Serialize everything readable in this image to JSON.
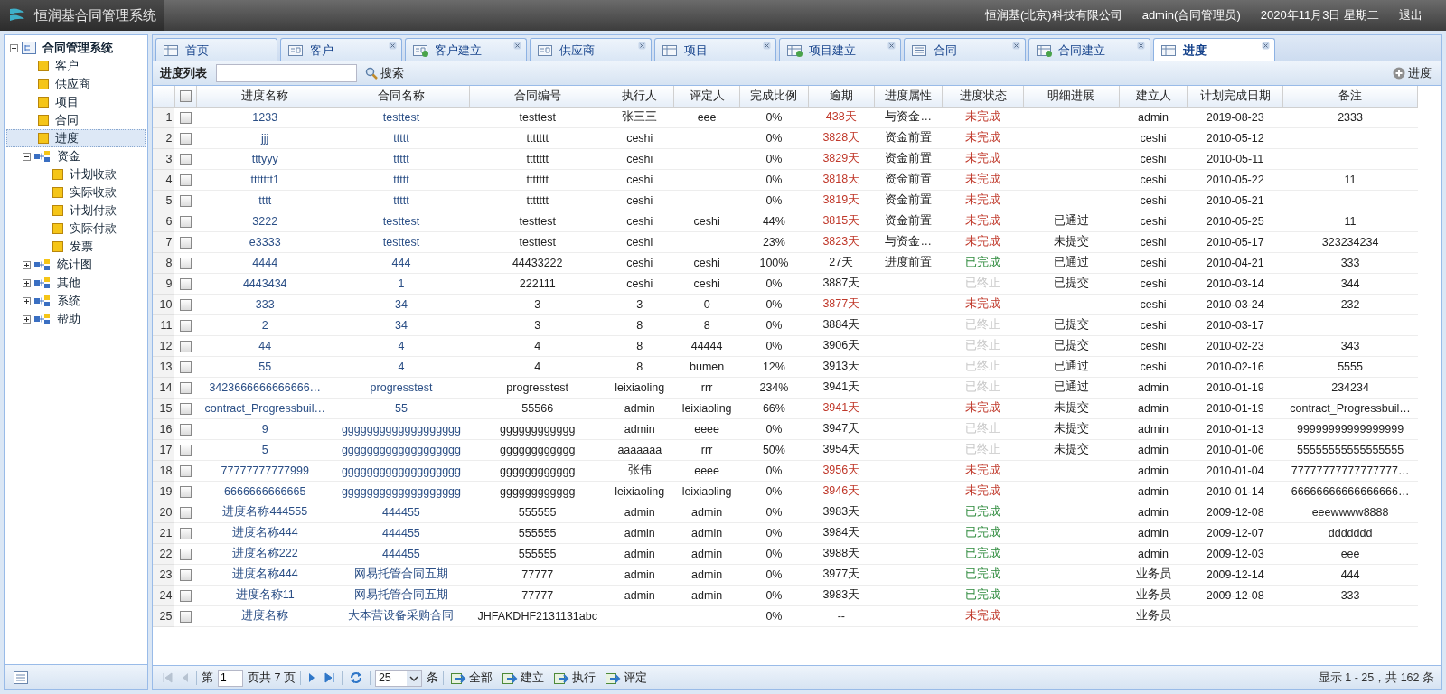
{
  "header": {
    "title": "恒润基合同管理系统",
    "company": "恒润基(北京)科技有限公司",
    "user": "admin(合同管理员)",
    "date": "2020年11月3日 星期二",
    "logout": "退出"
  },
  "sidebar": {
    "tree": [
      {
        "label": "合同管理系统",
        "kind": "root",
        "expanded": true,
        "children": [
          {
            "label": "客户",
            "kind": "leaf",
            "selected": false
          },
          {
            "label": "供应商",
            "kind": "leaf",
            "selected": false
          },
          {
            "label": "项目",
            "kind": "leaf",
            "selected": false
          },
          {
            "label": "合同",
            "kind": "leaf",
            "selected": false
          },
          {
            "label": "进度",
            "kind": "leaf",
            "selected": true
          },
          {
            "label": "资金",
            "kind": "folder",
            "expanded": true,
            "children": [
              {
                "label": "计划收款",
                "kind": "leaf",
                "selected": false
              },
              {
                "label": "实际收款",
                "kind": "leaf",
                "selected": false
              },
              {
                "label": "计划付款",
                "kind": "leaf",
                "selected": false
              },
              {
                "label": "实际付款",
                "kind": "leaf",
                "selected": false
              },
              {
                "label": "发票",
                "kind": "leaf",
                "selected": false
              }
            ]
          },
          {
            "label": "统计图",
            "kind": "folder",
            "expanded": false
          },
          {
            "label": "其他",
            "kind": "folder",
            "expanded": false
          },
          {
            "label": "系统",
            "kind": "folder",
            "expanded": false
          },
          {
            "label": "帮助",
            "kind": "folder",
            "expanded": false
          }
        ]
      }
    ]
  },
  "tabs": [
    {
      "label": "首页",
      "kind": "window",
      "closable": false,
      "selected": false
    },
    {
      "label": "客户",
      "kind": "card",
      "closable": true,
      "selected": false
    },
    {
      "label": "客户建立",
      "kind": "card-add",
      "closable": true,
      "selected": false
    },
    {
      "label": "供应商",
      "kind": "card",
      "closable": true,
      "selected": false
    },
    {
      "label": "项目",
      "kind": "window",
      "closable": true,
      "selected": false
    },
    {
      "label": "项目建立",
      "kind": "window-add",
      "closable": true,
      "selected": false
    },
    {
      "label": "合同",
      "kind": "list",
      "closable": true,
      "selected": false
    },
    {
      "label": "合同建立",
      "kind": "window-add",
      "closable": true,
      "selected": false
    },
    {
      "label": "进度",
      "kind": "window",
      "closable": true,
      "selected": true
    }
  ],
  "toolbar": {
    "title": "进度列表",
    "search_button": "搜索",
    "add_button": "进度"
  },
  "table": {
    "header_checked": false,
    "columns": [
      "进度名称",
      "合同名称",
      "合同编号",
      "执行人",
      "评定人",
      "完成比例",
      "逾期",
      "进度属性",
      "进度状态",
      "明细进展",
      "建立人",
      "计划完成日期",
      "备注"
    ],
    "rows": [
      {
        "no": "1",
        "checked": false,
        "name": "1233",
        "contract": "testtest",
        "code": "testtest",
        "executor": "张三三",
        "reviewer": "eee",
        "ratio": "0%",
        "overdue": "438天",
        "late": true,
        "attribute": "与资金…",
        "status": "未完成",
        "kind": "open",
        "creator": "admin",
        "due": "2019-08-23",
        "note": "2333"
      },
      {
        "no": "2",
        "checked": false,
        "name": "jjj",
        "contract": "ttttt",
        "code": "ttttttt",
        "executor": "ceshi",
        "ratio": "0%",
        "overdue": "3828天",
        "late": true,
        "attribute": "资金前置",
        "status": "未完成",
        "kind": "open",
        "creator": "ceshi",
        "due": "2010-05-12"
      },
      {
        "no": "3",
        "checked": false,
        "name": "tttyyy",
        "contract": "ttttt",
        "code": "ttttttt",
        "executor": "ceshi",
        "ratio": "0%",
        "overdue": "3829天",
        "late": true,
        "attribute": "资金前置",
        "status": "未完成",
        "kind": "open",
        "creator": "ceshi",
        "due": "2010-05-11"
      },
      {
        "no": "4",
        "checked": false,
        "name": "ttttttt1",
        "contract": "ttttt",
        "code": "ttttttt",
        "executor": "ceshi",
        "ratio": "0%",
        "overdue": "3818天",
        "late": true,
        "attribute": "资金前置",
        "status": "未完成",
        "kind": "open",
        "creator": "ceshi",
        "due": "2010-05-22",
        "note": "11"
      },
      {
        "no": "5",
        "checked": false,
        "name": "tttt",
        "contract": "ttttt",
        "code": "ttttttt",
        "executor": "ceshi",
        "ratio": "0%",
        "overdue": "3819天",
        "late": true,
        "attribute": "资金前置",
        "status": "未完成",
        "kind": "open",
        "creator": "ceshi",
        "due": "2010-05-21"
      },
      {
        "no": "6",
        "checked": false,
        "name": "3222",
        "contract": "testtest",
        "code": "testtest",
        "executor": "ceshi",
        "reviewer": "ceshi",
        "ratio": "44%",
        "overdue": "3815天",
        "late": true,
        "attribute": "资金前置",
        "status": "未完成",
        "kind": "open",
        "detail": "已通过",
        "creator": "ceshi",
        "due": "2010-05-25",
        "note": "11"
      },
      {
        "no": "7",
        "checked": false,
        "name": "e3333",
        "contract": "testtest",
        "code": "testtest",
        "executor": "ceshi",
        "ratio": "23%",
        "overdue": "3823天",
        "late": true,
        "attribute": "与资金…",
        "status": "未完成",
        "kind": "open",
        "detail": "未提交",
        "creator": "ceshi",
        "due": "2010-05-17",
        "note": "323234234"
      },
      {
        "no": "8",
        "checked": false,
        "name": "4444",
        "contract": "444",
        "code": "44433222",
        "executor": "ceshi",
        "reviewer": "ceshi",
        "ratio": "100%",
        "overdue": "27天",
        "late": false,
        "attribute": "进度前置",
        "status": "已完成",
        "kind": "done",
        "detail": "已通过",
        "creator": "ceshi",
        "due": "2010-04-21",
        "note": "333"
      },
      {
        "no": "9",
        "checked": false,
        "name": "4443434",
        "contract": "1",
        "code": "222111",
        "executor": "ceshi",
        "reviewer": "ceshi",
        "ratio": "0%",
        "overdue": "3887天",
        "late": false,
        "status": "已终止",
        "kind": "stopped",
        "detail": "已提交",
        "creator": "ceshi",
        "due": "2010-03-14",
        "note": "344"
      },
      {
        "no": "10",
        "checked": false,
        "name": "333",
        "contract": "34",
        "code": "3",
        "executor": "3",
        "reviewer": "0",
        "ratio": "0%",
        "overdue": "3877天",
        "late": true,
        "status": "未完成",
        "kind": "open",
        "creator": "ceshi",
        "due": "2010-03-24",
        "note": "232"
      },
      {
        "no": "11",
        "checked": false,
        "name": "2",
        "contract": "34",
        "code": "3",
        "executor": "8",
        "reviewer": "8",
        "ratio": "0%",
        "overdue": "3884天",
        "late": false,
        "status": "已终止",
        "kind": "stopped",
        "detail": "已提交",
        "creator": "ceshi",
        "due": "2010-03-17"
      },
      {
        "no": "12",
        "checked": false,
        "name": "44",
        "contract": "4",
        "code": "4",
        "executor": "8",
        "reviewer": "44444",
        "ratio": "0%",
        "overdue": "3906天",
        "late": false,
        "status": "已终止",
        "kind": "stopped",
        "detail": "已提交",
        "creator": "ceshi",
        "due": "2010-02-23",
        "note": "343"
      },
      {
        "no": "13",
        "checked": false,
        "name": "55",
        "contract": "4",
        "code": "4",
        "executor": "8",
        "reviewer": "bumen",
        "ratio": "12%",
        "overdue": "3913天",
        "late": false,
        "status": "已终止",
        "kind": "stopped",
        "detail": "已通过",
        "creator": "ceshi",
        "due": "2010-02-16",
        "note": "5555"
      },
      {
        "no": "14",
        "checked": false,
        "name": "3423666666666666…",
        "contract": "progresstest",
        "code": "progresstest",
        "executor": "leixiaoling",
        "reviewer": "rrr",
        "ratio": "234%",
        "overdue": "3941天",
        "late": false,
        "status": "已终止",
        "kind": "stopped",
        "detail": "已通过",
        "creator": "admin",
        "due": "2010-01-19",
        "note": "234234"
      },
      {
        "no": "15",
        "checked": false,
        "name": "contract_Progressbuil…",
        "contract": "55",
        "code": "55566",
        "executor": "admin",
        "reviewer": "leixiaoling",
        "ratio": "66%",
        "overdue": "3941天",
        "late": true,
        "status": "未完成",
        "kind": "open",
        "detail": "未提交",
        "creator": "admin",
        "due": "2010-01-19",
        "note": "contract_Progressbuil…"
      },
      {
        "no": "16",
        "checked": false,
        "name": "9",
        "contract": "ggggggggggggggggggg",
        "code": "gggggggggggg",
        "executor": "admin",
        "reviewer": "eeee",
        "ratio": "0%",
        "overdue": "3947天",
        "late": false,
        "status": "已终止",
        "kind": "stopped",
        "detail": "未提交",
        "creator": "admin",
        "due": "2010-01-13",
        "note": "99999999999999999"
      },
      {
        "no": "17",
        "checked": false,
        "name": "5",
        "contract": "ggggggggggggggggggg",
        "code": "gggggggggggg",
        "executor": "aaaaaaa",
        "reviewer": "rrr",
        "ratio": "50%",
        "overdue": "3954天",
        "late": false,
        "status": "已终止",
        "kind": "stopped",
        "detail": "未提交",
        "creator": "admin",
        "due": "2010-01-06",
        "note": "55555555555555555"
      },
      {
        "no": "18",
        "checked": false,
        "name": "77777777777999",
        "contract": "ggggggggggggggggggg",
        "code": "gggggggggggg",
        "executor": "张伟",
        "reviewer": "eeee",
        "ratio": "0%",
        "overdue": "3956天",
        "late": true,
        "status": "未完成",
        "kind": "open",
        "creator": "admin",
        "due": "2010-01-04",
        "note": "77777777777777777…"
      },
      {
        "no": "19",
        "checked": false,
        "name": "6666666666665",
        "contract": "ggggggggggggggggggg",
        "code": "gggggggggggg",
        "executor": "leixiaoling",
        "reviewer": "leixiaoling",
        "ratio": "0%",
        "overdue": "3946天",
        "late": true,
        "status": "未完成",
        "kind": "open",
        "creator": "admin",
        "due": "2010-01-14",
        "note": "66666666666666666…"
      },
      {
        "no": "20",
        "checked": false,
        "name": "进度名称444555",
        "contract": "444455",
        "code": "555555",
        "executor": "admin",
        "reviewer": "admin",
        "ratio": "0%",
        "overdue": "3983天",
        "late": false,
        "status": "已完成",
        "kind": "done",
        "creator": "admin",
        "due": "2009-12-08",
        "note": "eeewwww8888"
      },
      {
        "no": "21",
        "checked": false,
        "name": "进度名称444",
        "contract": "444455",
        "code": "555555",
        "executor": "admin",
        "reviewer": "admin",
        "ratio": "0%",
        "overdue": "3984天",
        "late": false,
        "status": "已完成",
        "kind": "done",
        "creator": "admin",
        "due": "2009-12-07",
        "note": "ddddddd"
      },
      {
        "no": "22",
        "checked": false,
        "name": "进度名称222",
        "contract": "444455",
        "code": "555555",
        "executor": "admin",
        "reviewer": "admin",
        "ratio": "0%",
        "overdue": "3988天",
        "late": false,
        "status": "已完成",
        "kind": "done",
        "creator": "admin",
        "due": "2009-12-03",
        "note": "eee"
      },
      {
        "no": "23",
        "checked": false,
        "name": "进度名称444",
        "contract": "网易托管合同五期",
        "code": "77777",
        "executor": "admin",
        "reviewer": "admin",
        "ratio": "0%",
        "overdue": "3977天",
        "late": false,
        "status": "已完成",
        "kind": "done",
        "creator": "业务员",
        "due": "2009-12-14",
        "note": "444"
      },
      {
        "no": "24",
        "checked": false,
        "name": "进度名称11",
        "contract": "网易托管合同五期",
        "code": "77777",
        "executor": "admin",
        "reviewer": "admin",
        "ratio": "0%",
        "overdue": "3983天",
        "late": false,
        "status": "已完成",
        "kind": "done",
        "creator": "业务员",
        "due": "2009-12-08",
        "note": "333"
      },
      {
        "no": "25",
        "checked": false,
        "name": "进度名称",
        "contract": "大本营设备采购合同",
        "code": "JHFAKDHF2131131abc",
        "ratio": "0%",
        "overdue": "--",
        "late": false,
        "status": "未完成",
        "kind": "open",
        "creator": "业务员"
      }
    ]
  },
  "pager": {
    "page_prefix": "第",
    "page": "1",
    "page_suffix": "页共 7 页",
    "page_size": "25",
    "size_unit": "条",
    "buttons": [
      "全部",
      "建立",
      "执行",
      "评定"
    ],
    "summary": "显示 1 - 25，共 162 条"
  }
}
